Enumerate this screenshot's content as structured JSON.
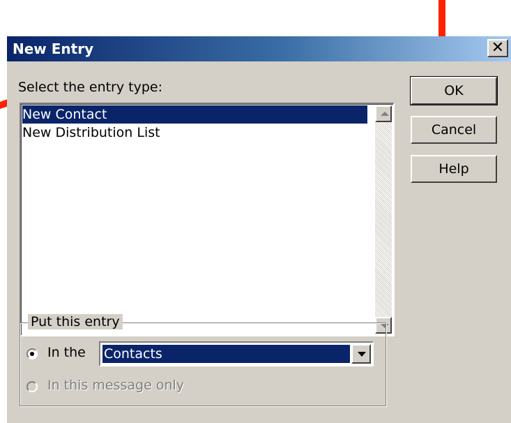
{
  "window": {
    "title": "New Entry",
    "close_glyph": "✕"
  },
  "entry_type": {
    "label": "Select the entry type:",
    "items": [
      {
        "label": "New Contact",
        "selected": true
      },
      {
        "label": "New Distribution List",
        "selected": false
      }
    ]
  },
  "buttons": {
    "ok": "OK",
    "cancel": "Cancel",
    "help": "Help"
  },
  "placement": {
    "group_label": "Put this entry",
    "option_in_the": "In the",
    "option_in_the_selected": true,
    "folder_value": "Contacts",
    "option_message_only": "In this message only",
    "option_message_only_enabled": false
  },
  "colors": {
    "selection": "#0a246a",
    "annotation_arrow": "#ff2200",
    "dialog_face": "#d4d0c8"
  }
}
